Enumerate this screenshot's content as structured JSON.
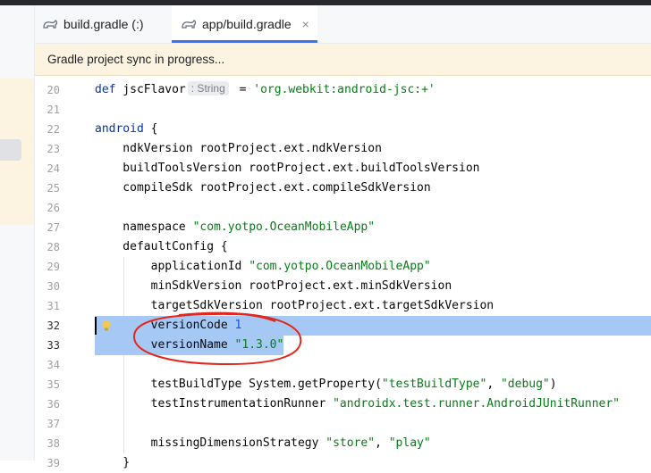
{
  "tabs": [
    {
      "label": "build.gradle (:)",
      "icon": "gradle-icon",
      "active": false
    },
    {
      "label": "app/build.gradle",
      "icon": "gradle-icon",
      "active": true,
      "close": "×"
    }
  ],
  "banner": {
    "text": "Gradle project sync in progress..."
  },
  "editor": {
    "lines": [
      {
        "num": "20",
        "code": "def jscFlavor",
        "hint": ": String",
        "rest": " = 'org.webkit:android-jsc:+'"
      },
      {
        "num": "21",
        "code": ""
      },
      {
        "num": "22",
        "code": "android {"
      },
      {
        "num": "23",
        "code": "    ndkVersion rootProject.ext.ndkVersion"
      },
      {
        "num": "24",
        "code": "    buildToolsVersion rootProject.ext.buildToolsVersion"
      },
      {
        "num": "25",
        "code": "    compileSdk rootProject.ext.compileSdkVersion"
      },
      {
        "num": "26",
        "code": ""
      },
      {
        "num": "27",
        "code": "    namespace \"com.yotpo.OceanMobileApp\""
      },
      {
        "num": "28",
        "code": "    defaultConfig {"
      },
      {
        "num": "29",
        "code": "        applicationId \"com.yotpo.OceanMobileApp\""
      },
      {
        "num": "30",
        "code": "        minSdkVersion rootProject.ext.minSdkVersion"
      },
      {
        "num": "31",
        "code": "        targetSdkVersion rootProject.ext.targetSdkVersion"
      },
      {
        "num": "32",
        "code": "        versionCode 1",
        "selected": true
      },
      {
        "num": "33",
        "code": "        versionName \"1.3.0\"",
        "selected": true
      },
      {
        "num": "34",
        "code": ""
      },
      {
        "num": "35",
        "code": "        testBuildType System.getProperty(\"testBuildType\", \"debug\")"
      },
      {
        "num": "36",
        "code": "        testInstrumentationRunner \"androidx.test.runner.AndroidJUnitRunner\""
      },
      {
        "num": "37",
        "code": ""
      },
      {
        "num": "38",
        "code": "        missingDimensionStrategy \"store\", \"play\""
      },
      {
        "num": "39",
        "code": "    }"
      }
    ]
  },
  "colors": {
    "selection": "#a6c8f5",
    "banner": "#fdf3e1",
    "annotation": "#e0281f",
    "accent": "#3574f0"
  }
}
